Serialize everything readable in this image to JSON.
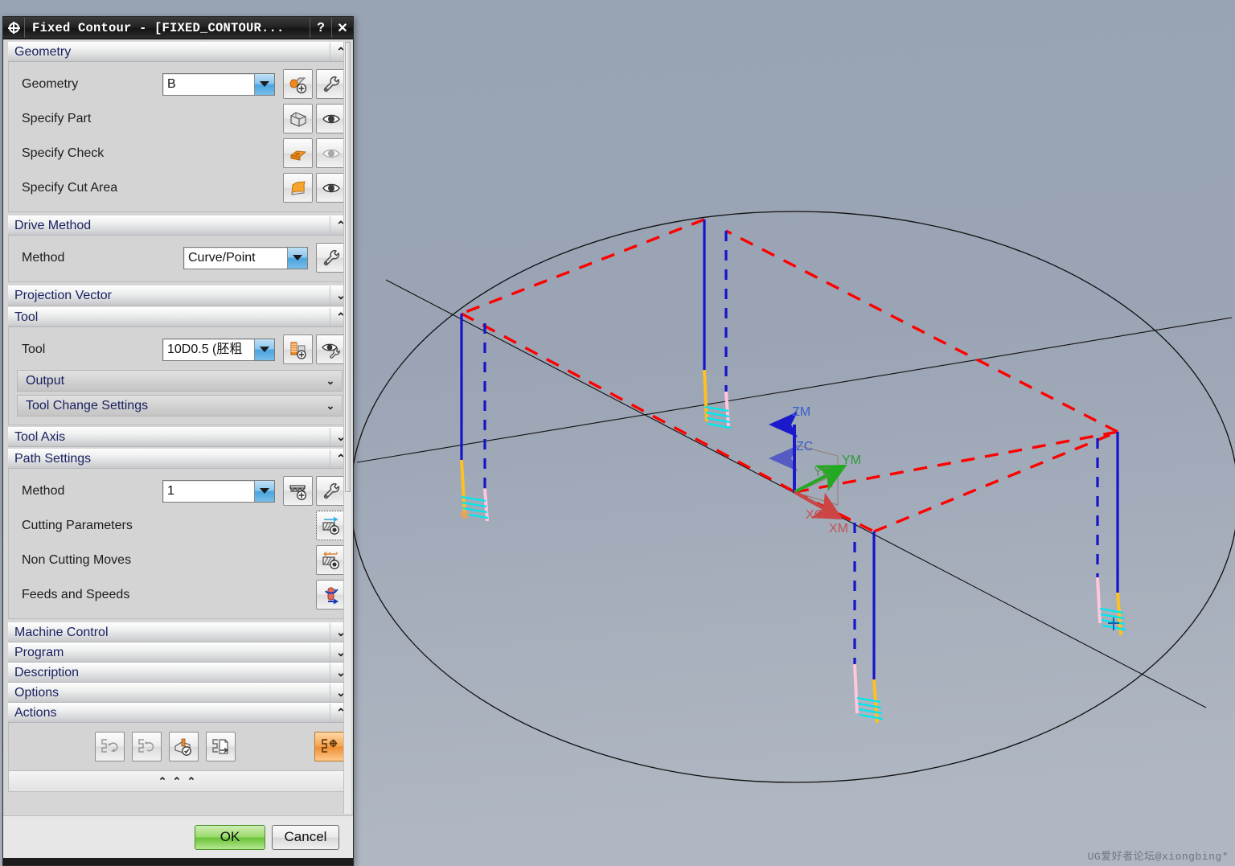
{
  "window": {
    "title": "Fixed Contour - [FIXED_CONTOUR...",
    "help_label": "?",
    "close_label": "✕",
    "menu_icon": "gear-icon"
  },
  "sections": {
    "geometry": {
      "title": "Geometry",
      "chevron": "⌃",
      "rows": [
        {
          "label": "Geometry",
          "value": "B",
          "icons": [
            "new-geometry-icon",
            "edit-wrench-icon"
          ]
        },
        {
          "label": "Specify Part",
          "icons": [
            "part-solid-icon",
            "display-eye-icon"
          ]
        },
        {
          "label": "Specify Check",
          "icons": [
            "check-body-icon",
            "display-eye-disabled-icon"
          ]
        },
        {
          "label": "Specify Cut Area",
          "icons": [
            "cut-area-icon",
            "display-eye-icon"
          ]
        }
      ]
    },
    "drive_method": {
      "title": "Drive Method",
      "chevron": "⌃",
      "method_label": "Method",
      "method_value": "Curve/Point",
      "edit_icon": "edit-wrench-icon"
    },
    "projection_vector": {
      "title": "Projection Vector",
      "chevron": "⌄"
    },
    "tool": {
      "title": "Tool",
      "chevron": "⌃",
      "tool_label": "Tool",
      "tool_value": "10D0.5 (胚粗",
      "icons": [
        "new-tool-icon",
        "edit-tool-wrench-icon"
      ],
      "subsections": [
        {
          "title": "Output",
          "chevron": "⌄"
        },
        {
          "title": "Tool Change Settings",
          "chevron": "⌄"
        }
      ]
    },
    "tool_axis": {
      "title": "Tool Axis",
      "chevron": "⌄"
    },
    "path_settings": {
      "title": "Path Settings",
      "chevron": "⌃",
      "method_label": "Method",
      "method_value": "1",
      "method_icons": [
        "new-method-icon",
        "edit-wrench-icon"
      ],
      "rows": [
        {
          "label": "Cutting Parameters",
          "icon": "cutting-parameters-icon"
        },
        {
          "label": "Non Cutting Moves",
          "icon": "non-cutting-moves-icon"
        },
        {
          "label": "Feeds and Speeds",
          "icon": "feeds-and-speeds-icon"
        }
      ]
    },
    "machine_control": {
      "title": "Machine Control",
      "chevron": "⌄"
    },
    "program": {
      "title": "Program",
      "chevron": "⌄"
    },
    "description": {
      "title": "Description",
      "chevron": "⌄"
    },
    "options": {
      "title": "Options",
      "chevron": "⌄"
    },
    "actions": {
      "title": "Actions",
      "chevron": "⌃",
      "buttons": [
        "generate-toolpath-icon",
        "replay-toolpath-icon",
        "verify-toolpath-icon",
        "list-toolpath-icon"
      ],
      "right_button": "confirm-point-icon"
    },
    "collapse_all": {
      "label": "⌃⌃⌃"
    }
  },
  "footer": {
    "ok_label": "OK",
    "cancel_label": "Cancel"
  },
  "viewport": {
    "axis_labels": {
      "zm": "ZM",
      "zc": "ZC",
      "ym": "YM",
      "yc": "YC",
      "xc": "XC",
      "xm": "XM"
    },
    "colors": {
      "rapid_move": "#ff0000",
      "cut_move": "#1414cc",
      "engage_move": "#ffc020",
      "retract_move": "#ffc6dc",
      "cut_region": "#00e8ee",
      "wcs_x": "#cc4444",
      "wcs_y": "#22aa22",
      "wcs_z": "#1a1acc",
      "part_edge": "#101010",
      "background_top": "#9aa5b5",
      "background_bottom": "#aeb5c0"
    },
    "watermark": "UG爱好者论坛@xiongbing*"
  }
}
